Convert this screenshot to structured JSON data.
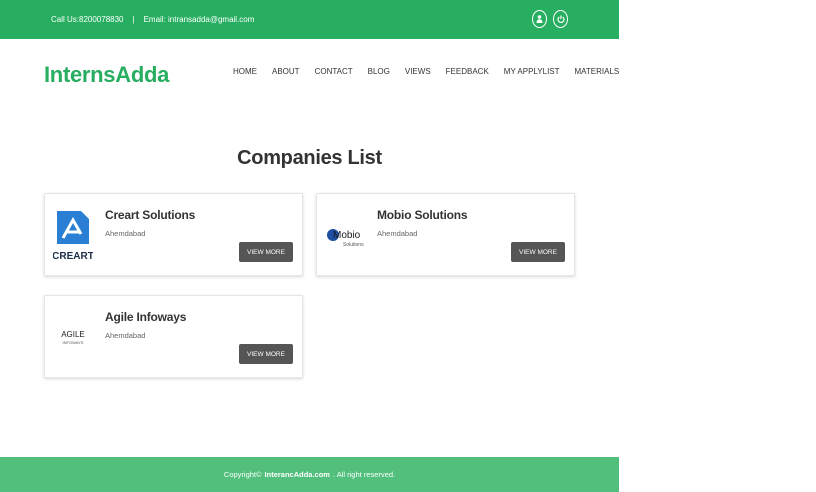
{
  "topbar": {
    "phone": "Call Us:8200078830",
    "separator": "|",
    "email": "Email: intransadda@gmail.com",
    "icons": [
      "user-icon",
      "power-icon"
    ]
  },
  "header": {
    "logo": "InternsAdda",
    "nav": [
      "HOME",
      "ABOUT",
      "CONTACT",
      "BLOG",
      "VIEWS",
      "FEEDBACK",
      "MY APPLYLIST",
      "MATERIALS"
    ]
  },
  "main": {
    "title": "Companies List",
    "companies": [
      {
        "name": "Creart Solutions",
        "city": "Ahemdabad",
        "button": "VIEW MORE",
        "logo_text": "CREART"
      },
      {
        "name": "Mobio Solutions",
        "city": "Ahemdabad",
        "button": "VIEW MORE",
        "logo_text": "Mobio",
        "logo_sub": "Solutions"
      },
      {
        "name": "Agile Infoways",
        "city": "Ahemdabad",
        "button": "VIEW MORE",
        "logo_text": "AGILE",
        "logo_sub": "INFOWAYS"
      }
    ]
  },
  "footer": {
    "prefix": "Copyright©",
    "brand": "InterancAdda.com",
    "suffix": ". All right reserved."
  },
  "colors": {
    "primary": "#27ae60",
    "footer": "#52bf7c",
    "button": "#555555",
    "creart_blue": "#2a7fd4"
  }
}
